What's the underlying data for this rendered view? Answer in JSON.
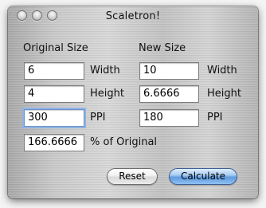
{
  "window": {
    "title": "Scaletron!"
  },
  "original": {
    "header": "Original Size",
    "width_value": "6",
    "width_label": "Width",
    "height_value": "4",
    "height_label": "Height",
    "ppi_value": "300",
    "ppi_label": "PPI"
  },
  "new_size": {
    "header": "New Size",
    "width_value": "10",
    "width_label": "Width",
    "height_value": "6.6666",
    "height_label": "Height",
    "ppi_value": "180",
    "ppi_label": "PPI"
  },
  "percent": {
    "value": "166.6666",
    "label": "% of Original"
  },
  "buttons": {
    "reset": "Reset",
    "calculate": "Calculate"
  },
  "colors": {
    "focus_ring": "#8fb2e3",
    "default_button": "#5f9be0"
  }
}
